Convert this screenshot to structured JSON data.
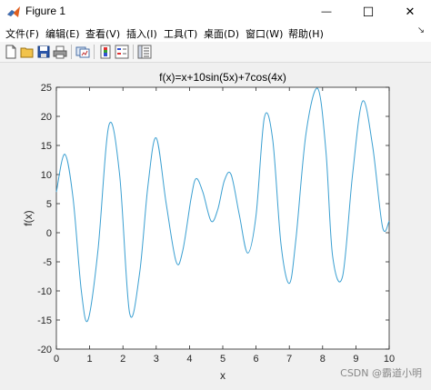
{
  "window": {
    "title": "Figure 1",
    "minimize_glyph": "—",
    "maximize_glyph": "☐",
    "close_glyph": "✕"
  },
  "menu": {
    "items": [
      {
        "label": "文件(F)"
      },
      {
        "label": "编辑(E)"
      },
      {
        "label": "查看(V)"
      },
      {
        "label": "插入(I)"
      },
      {
        "label": "工具(T)"
      },
      {
        "label": "桌面(D)"
      },
      {
        "label": "窗口(W)"
      },
      {
        "label": "帮助(H)"
      }
    ]
  },
  "toolbar": {
    "icons": [
      "new-figure-icon",
      "open-file-icon",
      "save-icon",
      "print-icon",
      "link-plot-icon",
      "colorbar-icon",
      "legend-icon",
      "property-inspector-icon"
    ]
  },
  "watermark": "CSDN @霸道小明",
  "colors": {
    "line": "#3a9fd1",
    "axes_bg": "#ffffff",
    "figure_bg": "#f0f0f0"
  },
  "chart_data": {
    "type": "line",
    "title": "f(x)=x+10sin(5x)+7cos(4x)",
    "xlabel": "x",
    "ylabel": "f(x)",
    "xlim": [
      0,
      10
    ],
    "ylim": [
      -20,
      25
    ],
    "xticks": [
      "0",
      "1",
      "2",
      "3",
      "4",
      "5",
      "6",
      "7",
      "8",
      "9",
      "10"
    ],
    "yticks": [
      "-20",
      "-15",
      "-10",
      "-5",
      "0",
      "5",
      "10",
      "15",
      "20",
      "25"
    ],
    "grid": false,
    "series": [
      {
        "x": [
          0,
          0.25,
          0.5,
          0.75,
          0.95,
          1.25,
          1.58,
          1.9,
          2.2,
          2.5,
          2.75,
          3.0,
          3.3,
          3.6,
          3.8,
          4.05,
          4.2,
          4.4,
          4.65,
          4.85,
          5.05,
          5.25,
          5.5,
          5.75,
          6.0,
          6.25,
          6.5,
          6.75,
          7.0,
          7.2,
          7.5,
          7.85,
          8.1,
          8.3,
          8.6,
          8.9,
          9.2,
          9.5,
          9.8,
          10
        ],
        "y": [
          7,
          13.5,
          6,
          -10,
          -15,
          -3,
          18.5,
          10,
          -13.8,
          -7,
          8,
          16.3,
          5,
          -5,
          -3,
          6,
          9.3,
          7,
          2,
          4,
          9,
          10,
          3,
          -3.5,
          3,
          19.8,
          16,
          -2,
          -8.7,
          -1,
          17,
          24.8,
          14,
          -4,
          -7.5,
          10,
          22.6,
          15,
          1,
          2
        ]
      }
    ]
  }
}
